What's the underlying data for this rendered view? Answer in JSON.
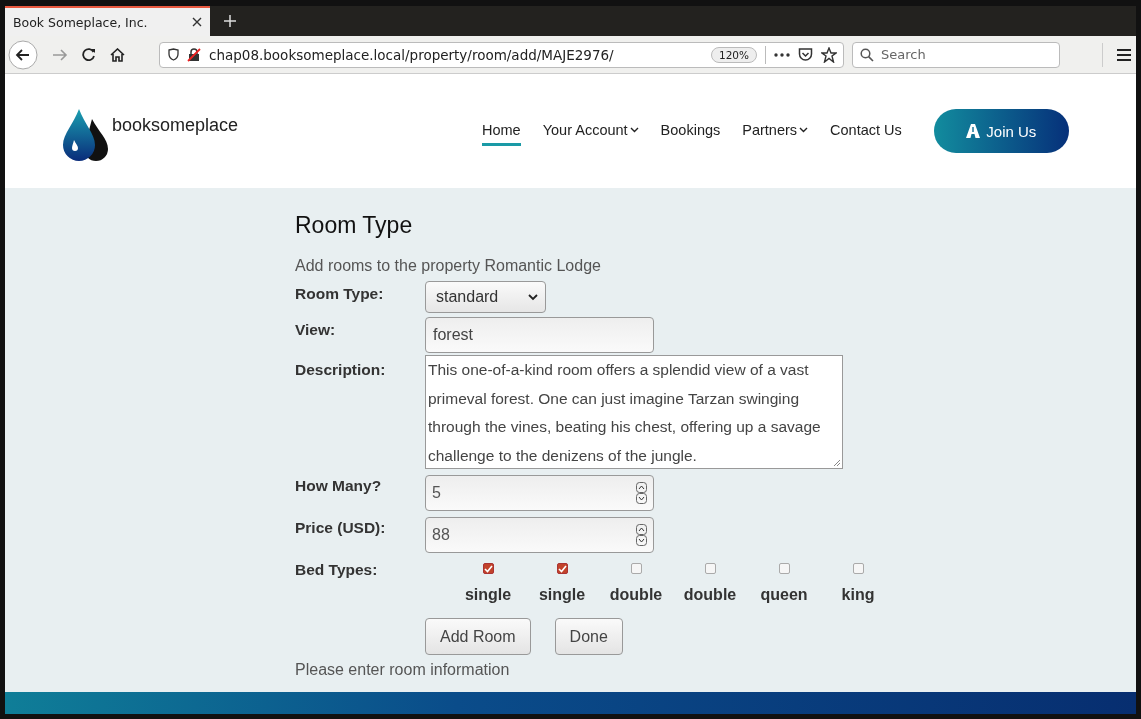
{
  "browser": {
    "tab_title": "Book Someplace, Inc.",
    "url": "chap08.booksomeplace.local/property/room/add/MAJE2976/",
    "zoom": "120%",
    "search_placeholder": "Search"
  },
  "site": {
    "logo_text": "booksomeplace",
    "nav": [
      {
        "label": "Home",
        "selected": true,
        "has_menu": false
      },
      {
        "label": "Your Account",
        "selected": false,
        "has_menu": true
      },
      {
        "label": "Bookings",
        "selected": false,
        "has_menu": false
      },
      {
        "label": "Partners",
        "selected": false,
        "has_menu": true
      },
      {
        "label": "Contact Us",
        "selected": false,
        "has_menu": false
      }
    ],
    "join_button": "Join Us"
  },
  "form": {
    "title": "Room Type",
    "subtitle": "Add rooms to the property Romantic Lodge",
    "fields": [
      {
        "kind": "select",
        "label": "Room Type:",
        "value": "standard"
      },
      {
        "kind": "text",
        "label": "View:",
        "value": "forest"
      },
      {
        "kind": "textarea",
        "label": "Description:",
        "value": "This one-of-a-kind room offers a splendid view of a vast primeval forest.  One can just imagine Tarzan swinging through the vines, beating his chest, offering up a savage challenge to the denizens of the jungle."
      },
      {
        "kind": "number",
        "label": "How Many?",
        "value": "5"
      },
      {
        "kind": "number",
        "label": "Price (USD):",
        "value": "88"
      }
    ],
    "bed_types_label": "Bed Types:",
    "bed_types": [
      {
        "label": "single",
        "checked": true
      },
      {
        "label": "single",
        "checked": true
      },
      {
        "label": "double",
        "checked": false
      },
      {
        "label": "double",
        "checked": false
      },
      {
        "label": "queen",
        "checked": false
      },
      {
        "label": "king",
        "checked": false
      }
    ],
    "buttons": [
      "Add Room",
      "Done"
    ],
    "status": "Please enter room information"
  }
}
